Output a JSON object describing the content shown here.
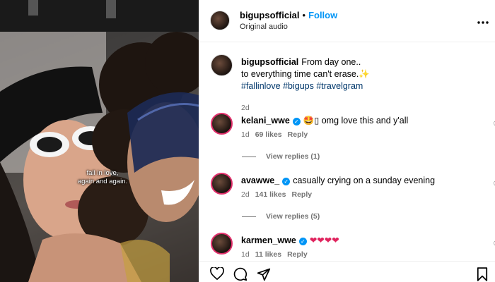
{
  "media": {
    "overlay_line1": "fall in love,",
    "overlay_line2": "again and again."
  },
  "header": {
    "username": "bigupsofficial",
    "separator": "•",
    "follow_label": "Follow",
    "audio": "Original audio",
    "more_icon": "more-horizontal-icon"
  },
  "post": {
    "username": "bigupsofficial",
    "line1": "From day one..",
    "line2": "to everything time can't erase.",
    "emoji": "✨",
    "hashtags": "#fallinlove #bigups #travelgram",
    "age": "2d"
  },
  "comments": [
    {
      "username": "kelani_wwe",
      "text": "🤩▯ omg love this and y'all",
      "age": "1d",
      "likes": "69 likes",
      "reply_label": "Reply",
      "replies": "View replies (1)"
    },
    {
      "username": "avawwe_",
      "text": "casually crying on a sunday evening",
      "age": "2d",
      "likes": "141 likes",
      "reply_label": "Reply",
      "replies": "View replies (5)"
    },
    {
      "username": "karmen_wwe",
      "text": "❤❤❤❤",
      "age": "1d",
      "likes": "11 likes",
      "reply_label": "Reply"
    }
  ],
  "colors": {
    "accent_blue": "#0095f6",
    "story_ring": "#e1306c",
    "heart_red": "#e0245e"
  }
}
